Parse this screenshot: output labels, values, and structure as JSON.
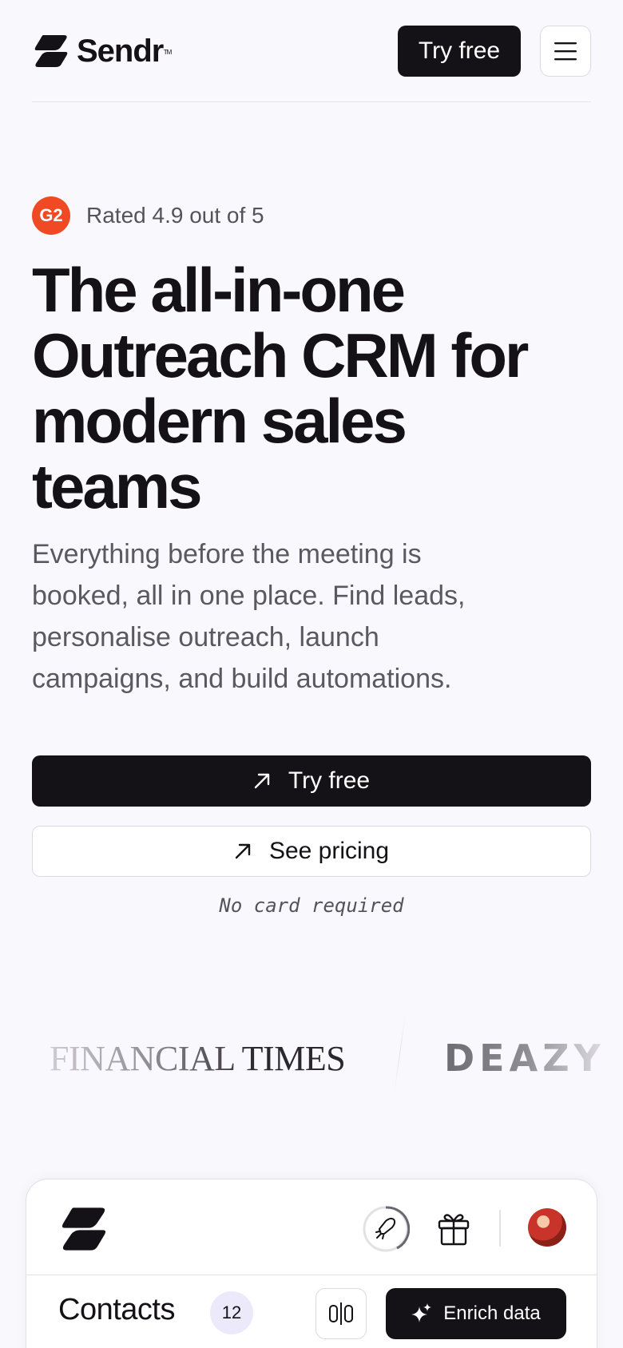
{
  "header": {
    "brand": "Sendr",
    "brand_tm": "TM",
    "try_free_label": "Try free",
    "menu_icon": "hamburger-menu-icon"
  },
  "hero": {
    "rating_badge": "G2",
    "rating_text": "Rated 4.9 out of 5",
    "title": "The all-in-one Outreach CRM for modern sales teams",
    "subtitle": "Everything before the meeting is booked, all in one place. Find leads, personalise outreach, launch campaigns, and build automations.",
    "cta_primary_label": "Try free",
    "cta_secondary_label": "See pricing",
    "cta_icon": "arrow-up-right-icon",
    "note": "No card required"
  },
  "logos": {
    "items": [
      "FINANCIAL TIMES",
      "DEAZY"
    ]
  },
  "app_preview": {
    "title": "Contacts",
    "count": "12",
    "enrich_label": "Enrich data",
    "icons": [
      "rocket-icon",
      "gift-icon",
      "columns-icon",
      "sparkle-icon"
    ]
  },
  "colors": {
    "background": "#f9f8fc",
    "primary": "#141217",
    "g2_badge": "#ef4a23",
    "count_badge": "#ebe9fa"
  }
}
